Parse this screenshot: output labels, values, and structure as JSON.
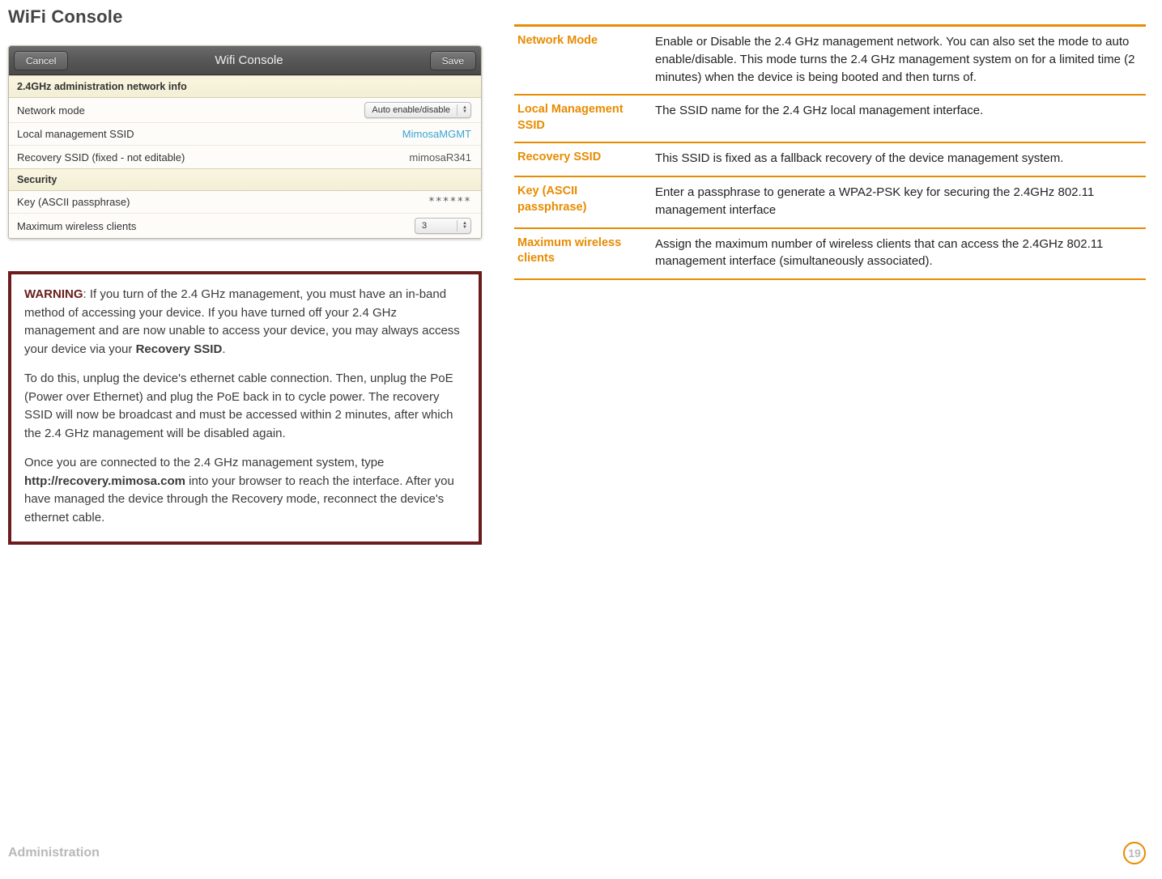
{
  "page_title": "WiFi Console",
  "panel": {
    "cancel": "Cancel",
    "title": "Wifi Console",
    "save": "Save",
    "sections": {
      "admin_header": "2.4GHz administration network info",
      "network_mode_label": "Network mode",
      "network_mode_value": "Auto enable/disable",
      "local_ssid_label": "Local management SSID",
      "local_ssid_value": "MimosaMGMT",
      "recovery_ssid_label": "Recovery SSID (fixed - not editable)",
      "recovery_ssid_value": "mimosaR341",
      "security_header": "Security",
      "key_label": "Key (ASCII passphrase)",
      "key_value": "******",
      "max_clients_label": "Maximum wireless clients",
      "max_clients_value": "3"
    }
  },
  "warning": {
    "title": "WARNING",
    "p1_a": ": If you turn of the 2.4 GHz management, you must have an in-band method of accessing your device. If you have turned off your 2.4 GHz management and are now unable to access your device, you may always access your device via your ",
    "p1_b": "Recovery SSID",
    "p1_c": ".",
    "p2": "To do this, unplug the device's ethernet cable connection. Then, unplug the PoE (Power over Ethernet) and plug the PoE back in to cycle power. The recovery SSID will now be broadcast and must be accessed within 2 minutes, after which the 2.4 GHz management will be disabled again.",
    "p3_a": "Once you are connected to the 2.4 GHz management system, type ",
    "p3_b": "http://recovery.mimosa.com",
    "p3_c": " into your browser to reach the interface. After you have managed the device through the Recovery mode, reconnect the device's ethernet cable."
  },
  "definitions": [
    {
      "key": "Network Mode",
      "val": "Enable or Disable the 2.4 GHz management network. You can also set the mode to auto enable/disable. This mode turns the 2.4 GHz management system on for a limited time (2 minutes) when the device is being booted and then turns of."
    },
    {
      "key": "Local Management SSID",
      "val": "The SSID name for the 2.4 GHz local management interface."
    },
    {
      "key": "Recovery SSID",
      "val": "This SSID is fixed as a fallback recovery of the device management system."
    },
    {
      "key": "Key (ASCII passphrase)",
      "val": "Enter a passphrase to generate a WPA2-PSK key for securing the 2.4GHz 802.11 management interface"
    },
    {
      "key": "Maximum wireless clients",
      "val": "Assign the maximum number of wireless clients that can access the 2.4GHz 802.11 management interface (simultaneously associated)."
    }
  ],
  "footer": {
    "section": "Administration",
    "page": "19"
  }
}
